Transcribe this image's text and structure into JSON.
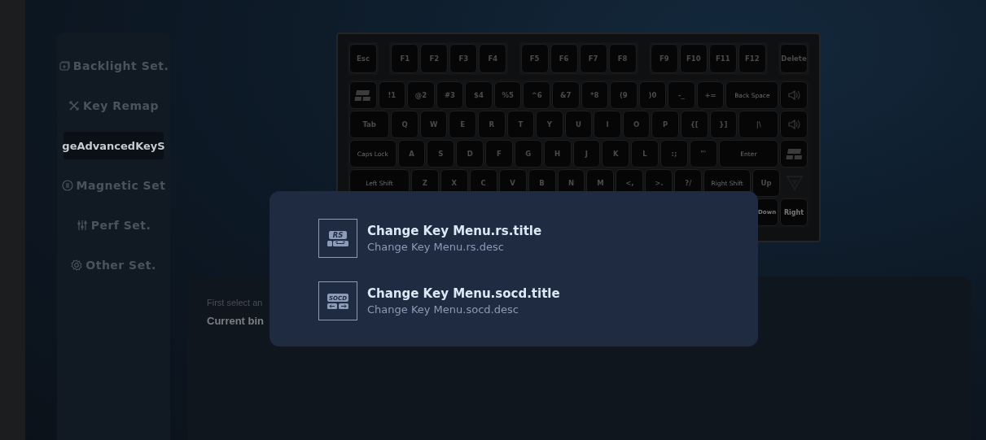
{
  "sidebar": {
    "items": [
      {
        "label": "Backlight Set.",
        "selected": false
      },
      {
        "label": "Key Remap",
        "selected": false
      },
      {
        "label": "geAdvancedKeyS",
        "selected": true
      },
      {
        "label": "Magnetic Set",
        "selected": false
      },
      {
        "label": "Perf Set.",
        "selected": false
      },
      {
        "label": "Other Set.",
        "selected": false
      }
    ]
  },
  "keyboard": {
    "function_groups": [
      [
        "Esc"
      ],
      [
        "F1",
        "F2",
        "F3",
        "F4"
      ],
      [
        "F5",
        "F6",
        "F7",
        "F8"
      ],
      [
        "F9",
        "F10",
        "F11",
        "F12"
      ],
      [
        "Delete"
      ]
    ],
    "rows": [
      [
        {
          "kind": "icon"
        },
        {
          "label": "!1"
        },
        {
          "label": "@2"
        },
        {
          "label": "#3"
        },
        {
          "label": "$4"
        },
        {
          "label": "%5"
        },
        {
          "label": "^6"
        },
        {
          "label": "&7"
        },
        {
          "label": "*8"
        },
        {
          "label": "(9"
        },
        {
          "label": ")0"
        },
        {
          "label": "-_"
        },
        {
          "label": "+="
        },
        {
          "label": "Back Space"
        },
        {
          "kind": "icon"
        }
      ],
      [
        {
          "label": "Tab"
        },
        {
          "label": "Q"
        },
        {
          "label": "W"
        },
        {
          "label": "E"
        },
        {
          "label": "R"
        },
        {
          "label": "T"
        },
        {
          "label": "Y"
        },
        {
          "label": "U"
        },
        {
          "label": "I"
        },
        {
          "label": "O"
        },
        {
          "label": "P"
        },
        {
          "label": "{["
        },
        {
          "label": "}]"
        },
        {
          "label": "|\\"
        },
        {
          "kind": "icon"
        }
      ],
      [
        {
          "label": "Caps Lock"
        },
        {
          "label": "A"
        },
        {
          "label": "S"
        },
        {
          "label": "D"
        },
        {
          "label": "F"
        },
        {
          "label": "G"
        },
        {
          "label": "H"
        },
        {
          "label": "J"
        },
        {
          "label": "K"
        },
        {
          "label": "L"
        },
        {
          "label": ":;"
        },
        {
          "label": "\"'"
        },
        {
          "label": "Enter"
        },
        {
          "kind": "icon"
        }
      ],
      [
        {
          "label": "Left Shift"
        },
        {
          "label": "Z"
        },
        {
          "label": "X"
        },
        {
          "label": "C"
        },
        {
          "label": "V"
        },
        {
          "label": "B"
        },
        {
          "label": "N"
        },
        {
          "label": "M"
        },
        {
          "label": "<,"
        },
        {
          "label": ">."
        },
        {
          "label": "?/"
        },
        {
          "label": "Right Shift"
        },
        {
          "label": "Up"
        },
        {
          "kind": "icon"
        }
      ]
    ],
    "arrow_keys": [
      "Down",
      "Right"
    ]
  },
  "panel": {
    "hint": "First select an",
    "binding": "Current bin"
  },
  "menu": {
    "items": [
      {
        "title": "Change Key Menu.rs.title",
        "desc": "Change Key Menu.rs.desc",
        "badge": "RS"
      },
      {
        "title": "Change Key Menu.socd.title",
        "desc": "Change Key Menu.socd.desc",
        "badge": "SOCD"
      }
    ]
  }
}
